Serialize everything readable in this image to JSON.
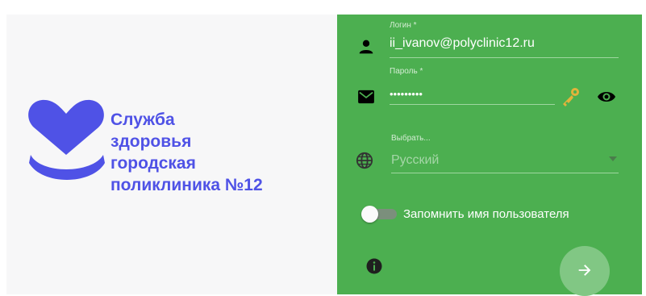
{
  "brand": {
    "lines": [
      "Служба",
      "здоровья",
      "городская",
      "поликлиника №12"
    ],
    "color": "#4f52e6"
  },
  "login": {
    "label": "Логин *",
    "value": "ii_ivanov@polyclinic12.ru",
    "icon": "person-icon"
  },
  "password": {
    "label": "Пароль *",
    "value": "•••••••••",
    "icon": "mail-icon",
    "key_icon": "key-icon",
    "toggle_icon": "eye-icon"
  },
  "language": {
    "label": "Выбрать...",
    "value": "Русский",
    "icon": "globe-icon"
  },
  "remember": {
    "label": "Запомнить имя пользователя",
    "checked": false
  },
  "info_icon": "info-icon",
  "submit_icon": "arrow-right-icon",
  "colors": {
    "panel": "#4caf50",
    "fab": "#81c784",
    "background": "#f7f7f8"
  }
}
